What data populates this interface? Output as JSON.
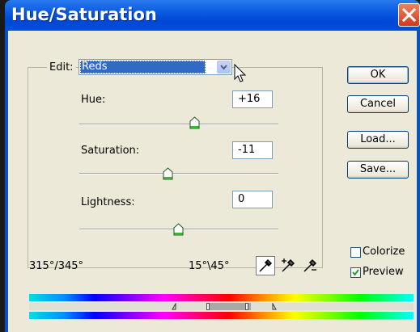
{
  "dialog": {
    "title": "Hue/Saturation",
    "edit_label": "Edit:",
    "edit_value": "Reds",
    "hue": {
      "label": "Hue:",
      "value": "+16"
    },
    "saturation": {
      "label": "Saturation:",
      "value": "-11"
    },
    "lightness": {
      "label": "Lightness:",
      "value": "0"
    },
    "buttons": {
      "ok": "OK",
      "cancel": "Cancel",
      "load": "Load...",
      "save": "Save..."
    },
    "colorize": {
      "label": "Colorize",
      "checked": false
    },
    "preview": {
      "label": "Preview",
      "checked": true
    },
    "range_left": "315°/345°",
    "range_right": "15°\\45°"
  },
  "icons": {
    "close": "close-icon",
    "dropdown": "chevron-down-icon",
    "eyedropper": "eyedropper-icon",
    "eyedropper_plus": "eyedropper-plus-icon",
    "eyedropper_minus": "eyedropper-minus-icon"
  },
  "colors": {
    "title_bar": "#0a5ae0",
    "close_button": "#d4381c",
    "dialog_bg": "#ece9d8",
    "selection": "#316ac5"
  }
}
